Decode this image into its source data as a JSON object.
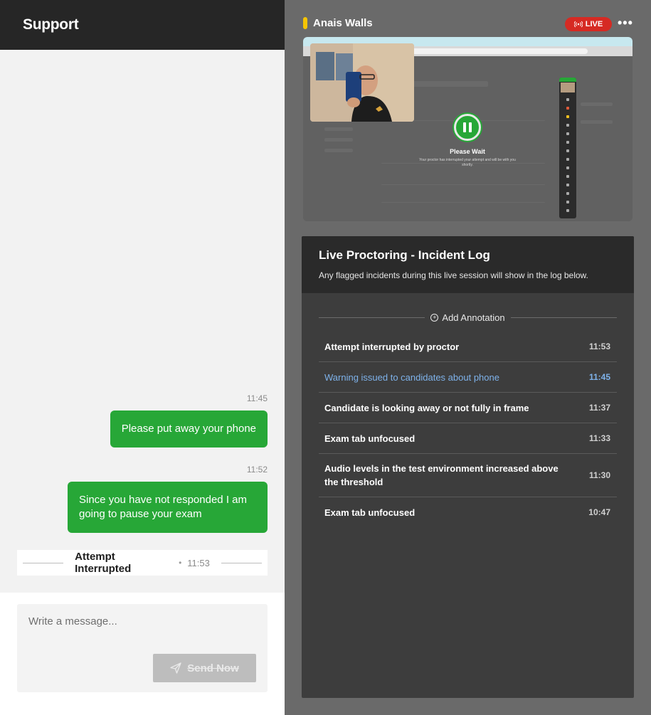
{
  "support": {
    "title": "Support",
    "messages": [
      {
        "time": "11:45",
        "text": "Please put away your phone"
      },
      {
        "time": "11:52",
        "text": "Since you have not responded I am going to pause your exam"
      }
    ],
    "interrupted": {
      "label": "Attempt Interrupted",
      "time": "11:53"
    },
    "composer": {
      "placeholder": "Write a message...",
      "send_label": "Send Now"
    }
  },
  "session": {
    "candidate_name": "Anais Walls",
    "live_label": "LIVE",
    "more": "•••",
    "screen": {
      "wait_title": "Please Wait",
      "wait_text": "Your proctor has interrupted your attempt and will be with you shortly."
    }
  },
  "incident_log": {
    "title": "Live Proctoring - Incident Log",
    "description": "Any flagged incidents during this live session will show in the log below.",
    "add_annotation": "Add Annotation",
    "items": [
      {
        "text": "Attempt interrupted by proctor",
        "time": "11:53",
        "highlight": false
      },
      {
        "text": "Warning issued to candidates about phone",
        "time": "11:45",
        "highlight": true
      },
      {
        "text": "Candidate is looking away or not fully in frame",
        "time": "11:37",
        "highlight": false
      },
      {
        "text": "Exam tab unfocused",
        "time": "11:33",
        "highlight": false
      },
      {
        "text": "Audio levels in the test environment increased above the threshold",
        "time": "11:30",
        "highlight": false
      },
      {
        "text": "Exam tab unfocused",
        "time": "10:47",
        "highlight": false
      }
    ]
  },
  "colors": {
    "accent_green": "#27a737",
    "live_red": "#d62a23",
    "candidate_marker": "#f7c500",
    "highlight_blue": "#7eb2ea"
  }
}
